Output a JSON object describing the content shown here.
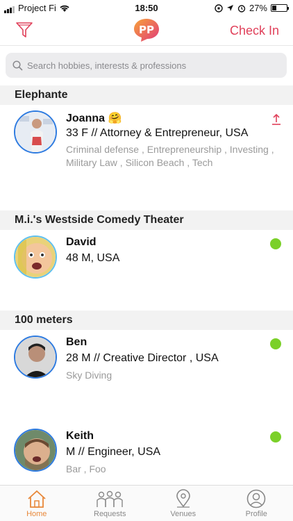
{
  "status_bar": {
    "carrier": "Project Fi",
    "time": "18:50",
    "battery": "27%"
  },
  "header": {
    "checkin_label": "Check In"
  },
  "search": {
    "placeholder": "Search hobbies, interests & professions"
  },
  "sections": [
    {
      "title": "Elephante",
      "people": [
        {
          "name": "Joanna 🤗",
          "detail": "33 F // Attorney & Entrepreneur,  USA",
          "tags": "Criminal defense , Entrepreneurship , Investing , Military Law , Silicon Beach , Tech",
          "status_icon": "upload-icon"
        }
      ]
    },
    {
      "title": "M.i.'s Westside Comedy Theater",
      "people": [
        {
          "name": "David",
          "detail": "48 M,  USA",
          "tags": "",
          "status_icon": "online-dot"
        }
      ]
    },
    {
      "title": "100 meters",
      "people": [
        {
          "name": "Ben",
          "detail": "28 M // Creative Director ,  USA",
          "tags": "Sky Diving",
          "status_icon": "online-dot"
        },
        {
          "name": "Keith",
          "detail": " M // Engineer,  USA",
          "tags": "Bar , Foo",
          "status_icon": "online-dot"
        }
      ]
    }
  ],
  "tabs": [
    {
      "label": "Home",
      "icon": "home-icon",
      "active": true
    },
    {
      "label": "Requests",
      "icon": "people-group-icon",
      "active": false
    },
    {
      "label": "Venues",
      "icon": "map-pin-icon",
      "active": false
    },
    {
      "label": "Profile",
      "icon": "profile-icon",
      "active": false
    }
  ],
  "colors": {
    "accent": "#e0405a",
    "online": "#7bd029",
    "tab_active": "#e8883a",
    "avatar_ring": "#2e7be0"
  }
}
